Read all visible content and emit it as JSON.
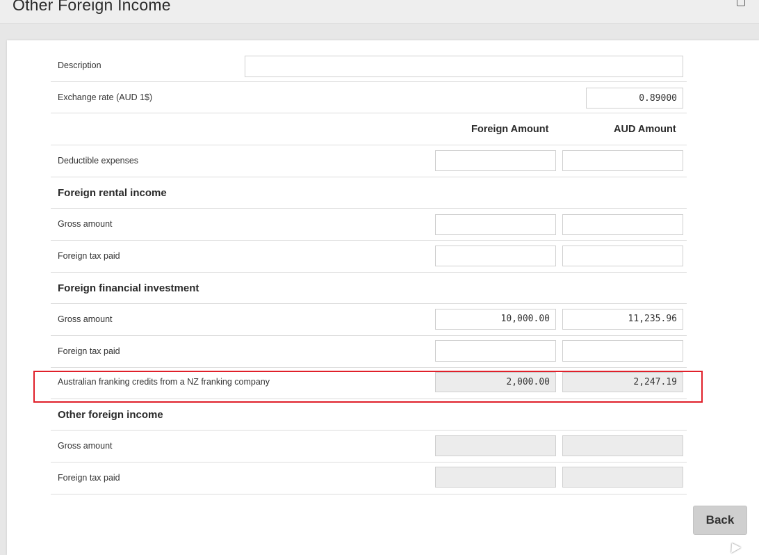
{
  "header": {
    "title": "Other Foreign Income"
  },
  "form": {
    "description_label": "Description",
    "description_value": "",
    "exchange_rate_label": "Exchange rate (AUD 1$)",
    "exchange_rate_value": "0.89000",
    "columns": {
      "foreign": "Foreign Amount",
      "aud": "AUD Amount"
    },
    "deductible_label": "Deductible expenses",
    "sections": {
      "rental": {
        "title": "Foreign rental income",
        "gross_label": "Gross amount",
        "tax_label": "Foreign tax paid"
      },
      "financial": {
        "title": "Foreign financial investment",
        "gross_label": "Gross amount",
        "gross_foreign": "10,000.00",
        "gross_aud": "11,235.96",
        "tax_label": "Foreign tax paid",
        "franking_label": "Australian franking credits from a NZ franking company",
        "franking_foreign": "2,000.00",
        "franking_aud": "2,247.19"
      },
      "other": {
        "title": "Other foreign income",
        "gross_label": "Gross amount",
        "tax_label": "Foreign tax paid"
      }
    }
  },
  "actions": {
    "back_label": "Back"
  },
  "colors": {
    "highlight": "#e0202a",
    "disabled_field": "#ececec"
  }
}
